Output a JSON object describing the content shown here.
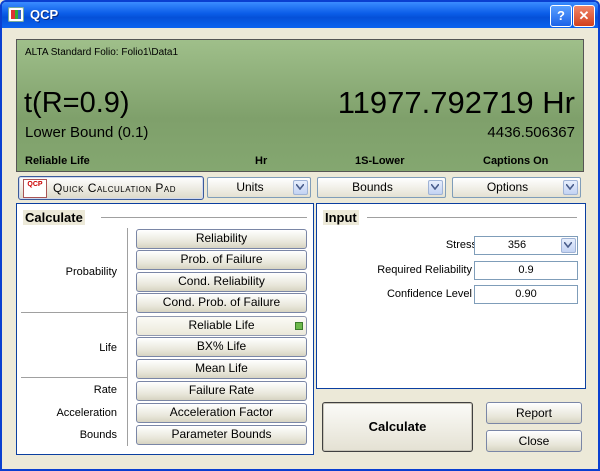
{
  "window": {
    "title": "QCP",
    "help_label": "?",
    "close_label": "✕"
  },
  "display": {
    "folio": "ALTA Standard Folio: Folio1\\Data1",
    "metric": "t(R=0.9)",
    "value": "11977.792719 Hr",
    "bound_label": "Lower Bound (0.1)",
    "bound_value": "4436.506367",
    "captions": [
      "Reliable Life",
      "Hr",
      "1S-Lower",
      "Captions On"
    ]
  },
  "toolbar": {
    "qcp_icon_text": "QCP",
    "qcp_label": "Quick Calculation Pad",
    "units": "Units",
    "bounds": "Bounds",
    "options": "Options"
  },
  "calculate": {
    "title": "Calculate",
    "categories": [
      "Probability",
      "Life",
      "Rate",
      "Acceleration",
      "Bounds"
    ],
    "buttons": {
      "reliability": "Reliability",
      "prob_failure": "Prob. of Failure",
      "cond_reliability": "Cond. Reliability",
      "cond_prob_failure": "Cond. Prob. of Failure",
      "reliable_life": "Reliable Life",
      "bx_life": "BX% Life",
      "mean_life": "Mean Life",
      "failure_rate": "Failure Rate",
      "acceleration_factor": "Acceleration Factor",
      "parameter_bounds": "Parameter Bounds"
    },
    "selected": "reliable_life"
  },
  "input": {
    "title": "Input",
    "stress_label": "Stress",
    "stress_value": "356",
    "req_rel_label": "Required Reliability",
    "req_rel_value": "0.9",
    "conf_label": "Confidence Level",
    "conf_value": "0.90"
  },
  "actions": {
    "calculate": "Calculate",
    "report": "Report",
    "close": "Close"
  },
  "colors": {
    "title_bar": "#0a5ce8",
    "display_bg": "#8fb07a",
    "selected_indicator": "#6cb84a"
  }
}
